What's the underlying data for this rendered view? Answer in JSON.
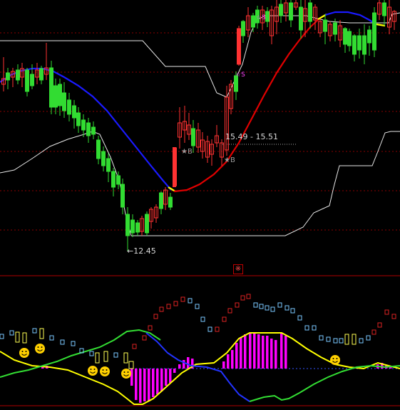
{
  "labels": {
    "low_price": "←12.45",
    "range": "15.49 - 15.51",
    "zoom_glyph": "※"
  },
  "markers": {
    "buy_marker_glyph": "★B",
    "sell_marker_glyph": "☆S",
    "smiley_glyph": "☺"
  },
  "colors": {
    "background": "#000000",
    "gridline": "#8b0000",
    "divider": "#b00000",
    "up_candle": "#ff3232",
    "down_candle": "#32dc32",
    "ma_up": "#e00000",
    "ma_down": "#1a1aff",
    "channel": "#e6e6e6",
    "macd_bar": "#ff00ff",
    "line_yellow": "#ffff00",
    "line_green": "#33dd33",
    "line_blue": "#2233ff",
    "box_red": "#dd2222",
    "box_cyan": "#7ac8ff",
    "box_yellow": "#ffff55",
    "smiley": "#ffd000"
  }
}
